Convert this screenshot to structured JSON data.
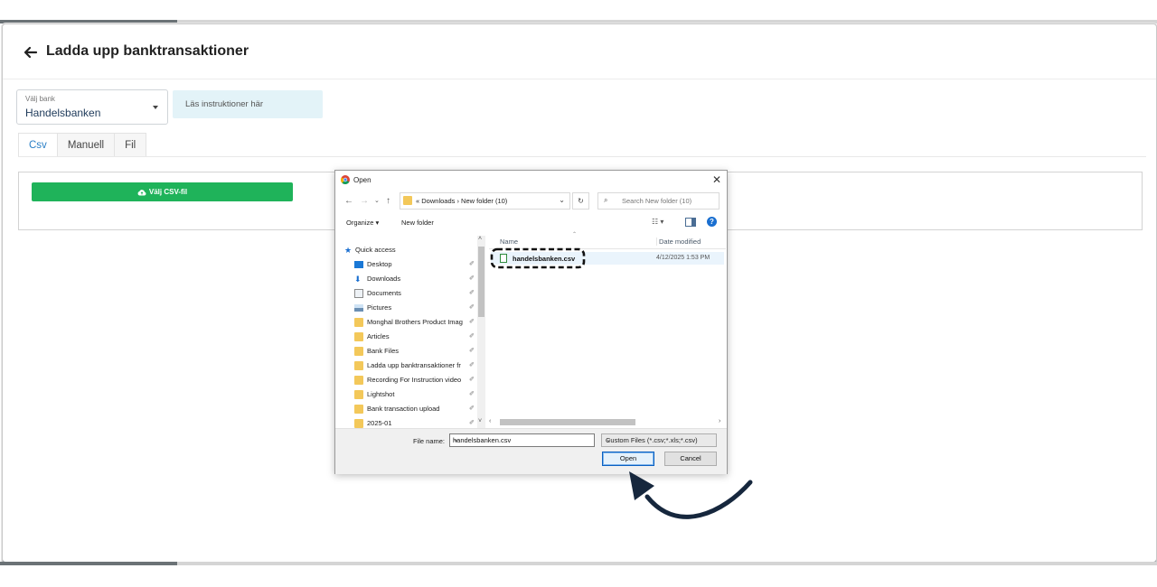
{
  "page": {
    "title": "Ladda upp banktransaktioner",
    "bank_select": {
      "label": "Välj bank",
      "value": "Handelsbanken"
    },
    "instructions_text": "Läs instruktioner här",
    "tabs": [
      {
        "label": "Csv",
        "active": true
      },
      {
        "label": "Manuell"
      },
      {
        "label": "Fil"
      }
    ],
    "csv_button_label": "Välj CSV-fil",
    "accent_color": "#2a7fc6",
    "button_color": "#1fb35a"
  },
  "dialog": {
    "title": "Open",
    "address": {
      "prefix": "«",
      "path": "Downloads  ›  New folder (10)"
    },
    "search_placeholder": "Search New folder (10)",
    "toolbar": {
      "organize": "Organize ▾",
      "new_folder": "New folder"
    },
    "nav": {
      "quick_access": "Quick access",
      "items": [
        {
          "label": "Desktop",
          "icon": "desktop-icon"
        },
        {
          "label": "Downloads",
          "icon": "download-icon"
        },
        {
          "label": "Documents",
          "icon": "documents-icon"
        },
        {
          "label": "Pictures",
          "icon": "pictures-icon"
        },
        {
          "label": "Monghal Brothers Product Imag",
          "icon": "folder-icon"
        },
        {
          "label": "Articles",
          "icon": "folder-icon"
        },
        {
          "label": "Bank Files",
          "icon": "folder-icon"
        },
        {
          "label": "Ladda upp banktransaktioner fr",
          "icon": "folder-icon"
        },
        {
          "label": "Recording For Instruction video",
          "icon": "folder-icon"
        },
        {
          "label": "Lightshot",
          "icon": "folder-icon"
        },
        {
          "label": "Bank transaction upload",
          "icon": "folder-icon"
        },
        {
          "label": "2025-01",
          "icon": "folder-icon"
        }
      ]
    },
    "columns": {
      "name": "Name",
      "date": "Date modified"
    },
    "files": [
      {
        "name": "handelsbanken.csv",
        "date": "4/12/2025 1:53 PM"
      }
    ],
    "file_name_label": "File name:",
    "file_name_value": "handelsbanken.csv",
    "file_type": "Custom Files (*.csv;*.xls;*.csv)",
    "open_label": "Open",
    "cancel_label": "Cancel"
  }
}
